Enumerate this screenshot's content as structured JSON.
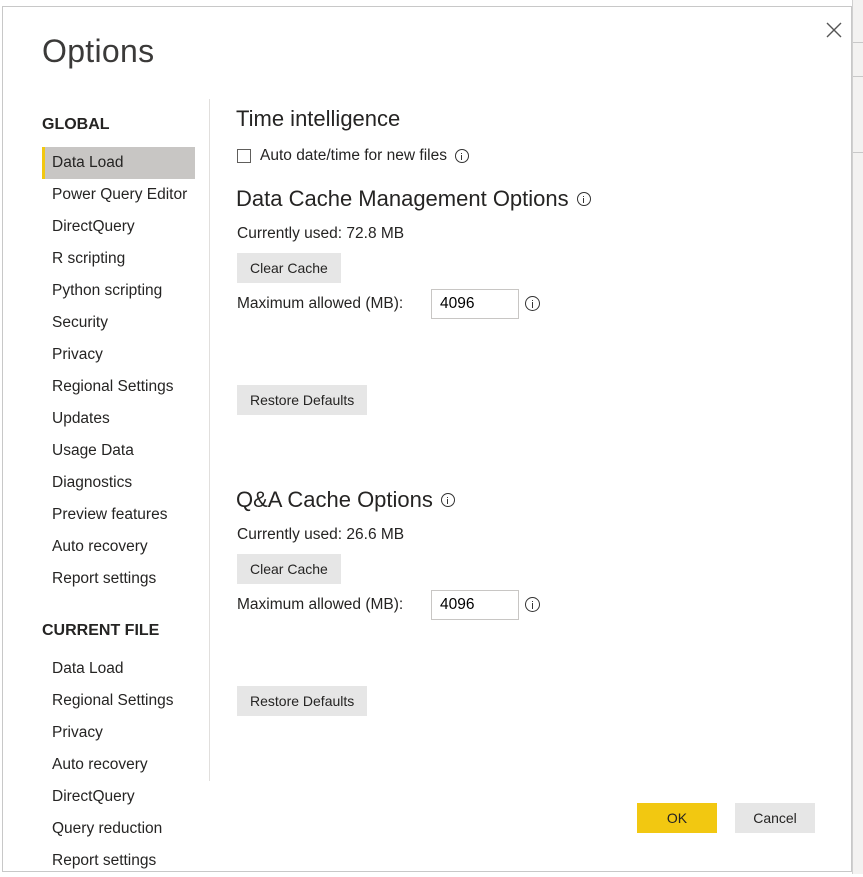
{
  "dialog": {
    "title": "Options",
    "close_icon": "close-icon"
  },
  "nav": {
    "global_heading": "GLOBAL",
    "global_items": [
      {
        "label": "Data Load",
        "selected": true
      },
      {
        "label": "Power Query Editor"
      },
      {
        "label": "DirectQuery"
      },
      {
        "label": "R scripting"
      },
      {
        "label": "Python scripting"
      },
      {
        "label": "Security"
      },
      {
        "label": "Privacy"
      },
      {
        "label": "Regional Settings"
      },
      {
        "label": "Updates"
      },
      {
        "label": "Usage Data"
      },
      {
        "label": "Diagnostics"
      },
      {
        "label": "Preview features"
      },
      {
        "label": "Auto recovery"
      },
      {
        "label": "Report settings"
      }
    ],
    "current_heading": "CURRENT FILE",
    "current_items": [
      {
        "label": "Data Load"
      },
      {
        "label": "Regional Settings"
      },
      {
        "label": "Privacy"
      },
      {
        "label": "Auto recovery"
      },
      {
        "label": "DirectQuery"
      },
      {
        "label": "Query reduction"
      },
      {
        "label": "Report settings"
      }
    ]
  },
  "time_intelligence": {
    "heading": "Time intelligence",
    "checkbox_label": "Auto date/time for new files",
    "checked": false
  },
  "data_cache": {
    "heading": "Data Cache Management Options",
    "currently_used": "Currently used: 72.8 MB",
    "clear_label": "Clear Cache",
    "max_label": "Maximum allowed (MB):",
    "max_value": "4096",
    "restore_label": "Restore Defaults"
  },
  "qa_cache": {
    "heading": "Q&A Cache Options",
    "currently_used": "Currently used: 26.6 MB",
    "clear_label": "Clear Cache",
    "max_label": "Maximum allowed (MB):",
    "max_value": "4096",
    "restore_label": "Restore Defaults"
  },
  "footer": {
    "ok_label": "OK",
    "cancel_label": "Cancel"
  },
  "colors": {
    "accent": "#f2c811",
    "selected_bg": "#c8c6c4",
    "button_bg": "#e6e6e6"
  }
}
